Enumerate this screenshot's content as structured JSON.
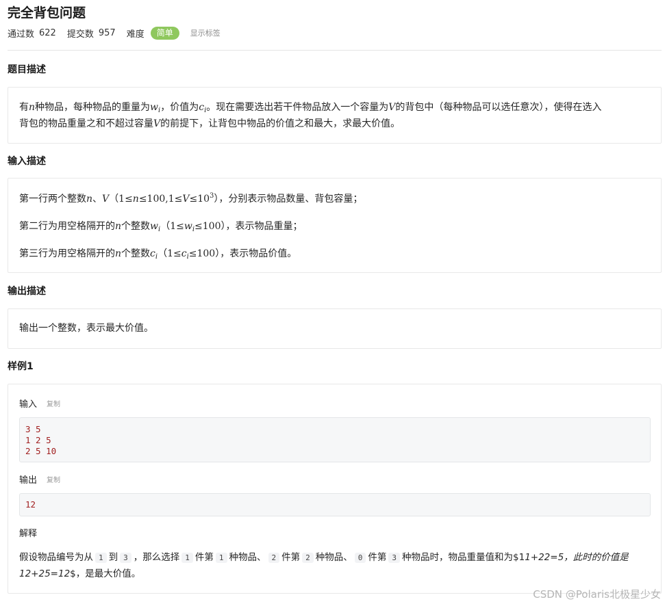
{
  "problem": {
    "title": "完全背包问题",
    "pass_label": "通过数",
    "pass_count": "622",
    "submit_label": "提交数",
    "submit_count": "957",
    "difficulty_label": "难度",
    "difficulty": "简单",
    "show_tags": "显示标签"
  },
  "description": {
    "heading": "题目描述",
    "line1_a": "有",
    "line1_n": "n",
    "line1_b": "种物品，每种物品的重量为",
    "line1_w": "w",
    "line1_wsub": "i",
    "line1_c_pre": "，价值为",
    "line1_c": "c",
    "line1_csub": "i",
    "line1_d": "。现在需要选出若干件物品放入一个容量为",
    "line1_V": "V",
    "line1_e": "的背包中（每种物品可以选任意次），使得在选入",
    "line2_a": "背包的物品重量之和不超过容量",
    "line2_V": "V",
    "line2_b": "的前提下，让背包中物品的价值之和最大，求最大价值。"
  },
  "input": {
    "heading": "输入描述",
    "l1_a": "第一行两个整数",
    "l1_n": "n",
    "l1_sep": "、",
    "l1_V": "V",
    "l1_open": "（",
    "l1_expr1": "1≤",
    "l1_n2": "n",
    "l1_expr2": "≤100,1≤",
    "l1_V2": "V",
    "l1_expr3": "≤10",
    "l1_exp": "3",
    "l1_close": "），分别表示物品数量、背包容量；",
    "l2_a": "第二行为用空格隔开的",
    "l2_n": "n",
    "l2_b": "个整数",
    "l2_w": "w",
    "l2_wsub": "i",
    "l2_open": "（",
    "l2_e1": "1≤",
    "l2_w2": "w",
    "l2_wsub2": "i",
    "l2_e2": "≤100",
    "l2_close": "），表示物品重量；",
    "l3_a": "第三行为用空格隔开的",
    "l3_n": "n",
    "l3_b": "个整数",
    "l3_c": "c",
    "l3_csub": "i",
    "l3_open": "（",
    "l3_e1": "1≤",
    "l3_c2": "c",
    "l3_csub2": "i",
    "l3_e2": "≤100",
    "l3_close": "），表示物品价值。"
  },
  "output": {
    "heading": "输出描述",
    "text": "输出一个整数，表示最大价值。"
  },
  "sample": {
    "heading": "样例1",
    "input_label": "输入",
    "copy_label": "复制",
    "input_lines": [
      "3 5",
      "1 2 5",
      "2 5 10"
    ],
    "output_label": "输出",
    "output_value": "12",
    "explain_label": "解释",
    "exp_a": "假设物品编号为从",
    "exp_c1": "1",
    "exp_b": "到",
    "exp_c2": "3",
    "exp_c": "，那么选择",
    "exp_c3": "1",
    "exp_d": "件第",
    "exp_c4": "1",
    "exp_e": "种物品、",
    "exp_c5": "2",
    "exp_f": "件第",
    "exp_c6": "2",
    "exp_g": "种物品、",
    "exp_c7": "0",
    "exp_h": "件第",
    "exp_c8": "3",
    "exp_i": "种物品时，物品重量值和为$1",
    "exp_it1": "1+22=5，此时的价值是",
    "exp_line2_it": "12+25=12",
    "exp_line2_b": "$，是最大价值。"
  },
  "watermark": "CSDN @Polaris北极星少女"
}
